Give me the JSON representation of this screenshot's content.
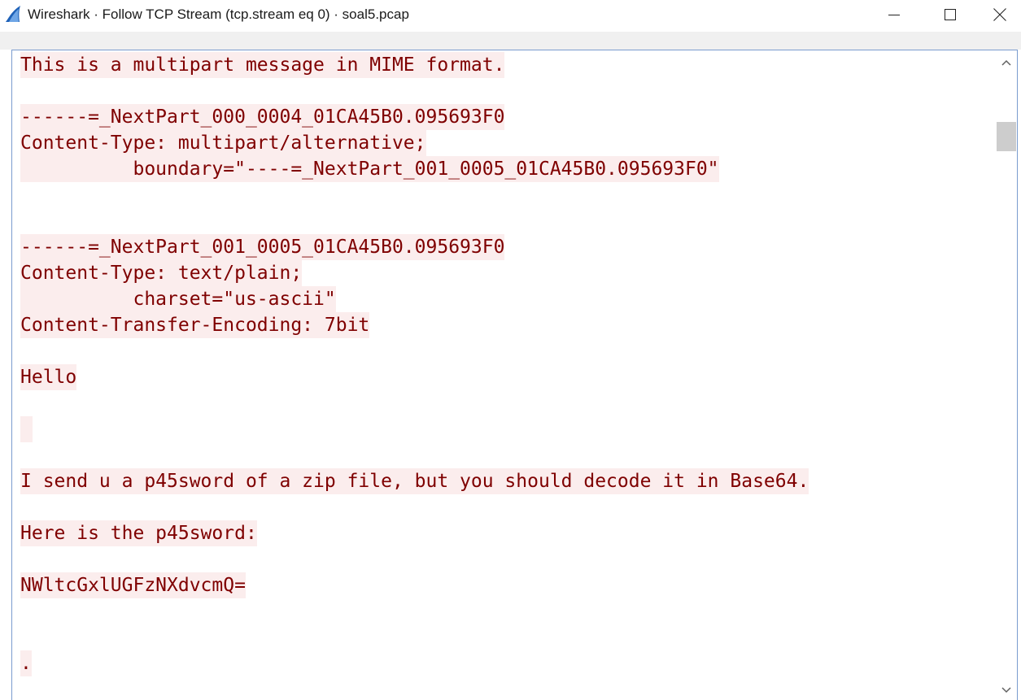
{
  "window": {
    "title": "Wireshark · Follow TCP Stream (tcp.stream eq 0) · soal5.pcap",
    "app_icon": "wireshark-fin-icon",
    "controls": {
      "minimize_icon": "minimize-icon",
      "maximize_icon": "maximize-icon",
      "close_icon": "close-icon"
    }
  },
  "stream": {
    "text_color": "#7f0000",
    "highlight_color": "#fbeded",
    "lines": [
      "This is a multipart message in MIME format.",
      "",
      "------=_NextPart_000_0004_01CA45B0.095693F0",
      "Content-Type: multipart/alternative;",
      "          boundary=\"----=_NextPart_001_0005_01CA45B0.095693F0\"",
      "",
      "",
      "------=_NextPart_001_0005_01CA45B0.095693F0",
      "Content-Type: text/plain;",
      "          charset=\"us-ascii\"",
      "Content-Transfer-Encoding: 7bit",
      "",
      "Hello",
      "",
      " ",
      "",
      "I send u a p45sword of a zip file, but you should decode it in Base64.",
      "",
      "Here is the p45sword:",
      "",
      "NWltcGxlUGFzNXdvcmQ=",
      "",
      "",
      "."
    ]
  },
  "scrollbar": {
    "up_icon": "scroll-up-arrow-icon",
    "down_icon": "scroll-down-arrow-icon"
  }
}
